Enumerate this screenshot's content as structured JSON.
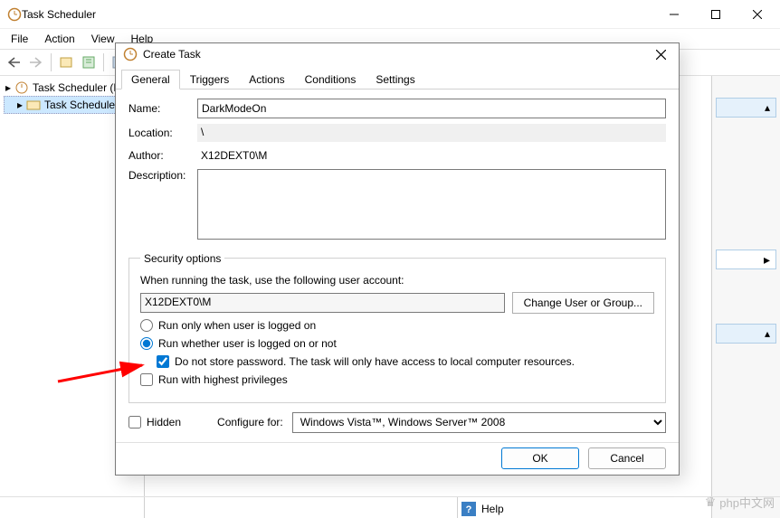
{
  "main": {
    "title": "Task Scheduler",
    "menus": [
      "File",
      "Action",
      "View",
      "Help"
    ],
    "tree": {
      "root": "Task Scheduler (L",
      "child": "Task Schedule"
    },
    "help_label": "Help"
  },
  "dialog": {
    "title": "Create Task",
    "tabs": [
      "General",
      "Triggers",
      "Actions",
      "Conditions",
      "Settings"
    ],
    "labels": {
      "name": "Name:",
      "location": "Location:",
      "author": "Author:",
      "description": "Description:",
      "security_legend": "Security options",
      "when_running": "When running the task, use the following user account:",
      "change_user_btn": "Change User or Group...",
      "radio_logged_on": "Run only when user is logged on",
      "radio_whether": "Run whether user is logged on or not",
      "chk_nostore": "Do not store password.  The task will only have access to local computer resources.",
      "chk_highest": "Run with highest privileges",
      "chk_hidden": "Hidden",
      "configure_for": "Configure for:",
      "ok": "OK",
      "cancel": "Cancel"
    },
    "values": {
      "name": "DarkModeOn",
      "location": "\\",
      "author": "X12DEXT0\\M",
      "description": "",
      "user_account": "X12DEXT0\\M",
      "configure_for": "Windows Vista™, Windows Server™ 2008"
    },
    "state": {
      "run_mode": "whether",
      "do_not_store": true,
      "highest_priv": false,
      "hidden": false
    }
  },
  "watermark": "php中文网"
}
